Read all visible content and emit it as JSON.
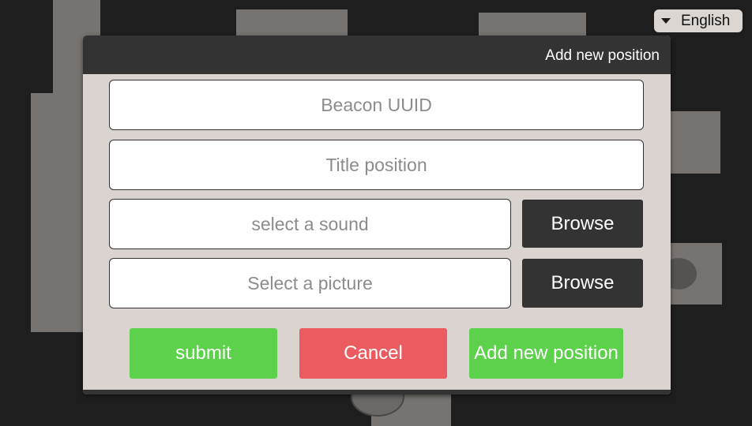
{
  "language_selector": {
    "value": "English",
    "icon": "caret-down-icon"
  },
  "dialog": {
    "title": "Add new position",
    "fields": {
      "beacon_uuid": {
        "placeholder": "Beacon UUID"
      },
      "title_position": {
        "placeholder": "Title position"
      },
      "sound": {
        "placeholder": "select a sound"
      },
      "picture": {
        "placeholder": "Select a picture"
      }
    },
    "browse_sound_label": "Browse",
    "browse_picture_label": "Browse",
    "buttons": {
      "submit": "submit",
      "cancel": "Cancel",
      "add_new": "Add new position"
    }
  },
  "colors": {
    "background": "#1e1e1e",
    "map_shape": "#767370",
    "dialog_body": "#dbd3d0",
    "dialog_header": "#333333",
    "submit_green": "#5dd04c",
    "cancel_red": "#eb5c61",
    "add_green": "#5dd04c"
  }
}
